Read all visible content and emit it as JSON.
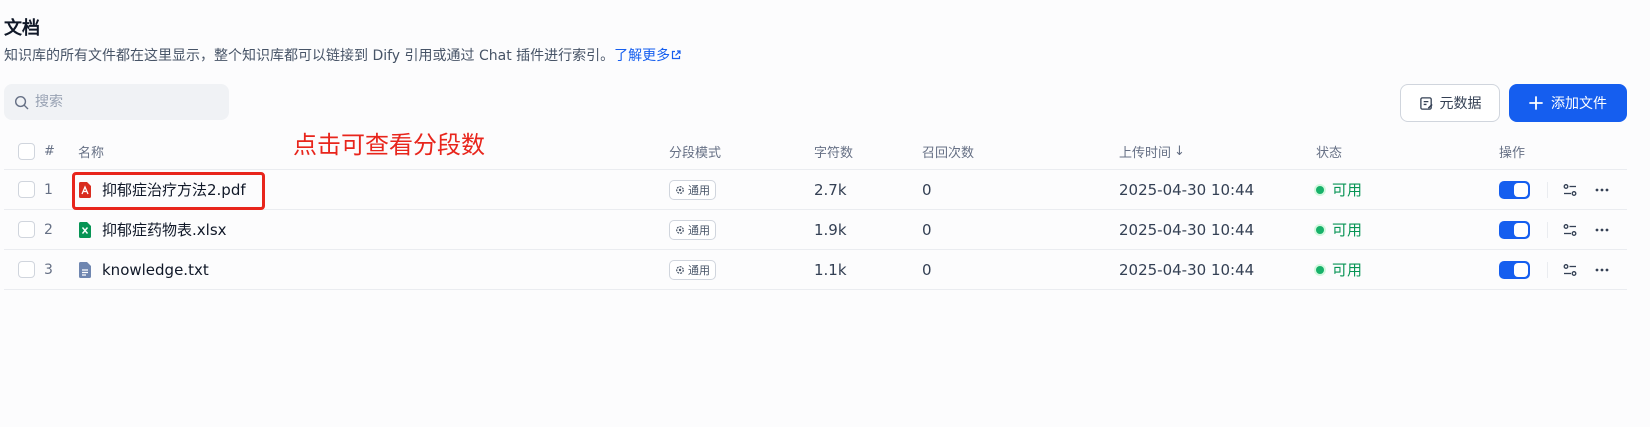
{
  "header": {
    "title": "文档",
    "description": "知识库的所有文件都在这里显示，整个知识库都可以链接到 Dify 引用或通过 Chat 插件进行索引。",
    "learn_more": "了解更多"
  },
  "search": {
    "placeholder": "搜索",
    "value": ""
  },
  "toolbar": {
    "metadata_label": "元数据",
    "add_file_label": "添加文件"
  },
  "annotation": "点击可查看分段数",
  "table": {
    "columns": {
      "num": "#",
      "name": "名称",
      "mode": "分段模式",
      "chars": "字符数",
      "recall": "召回次数",
      "upload_time": "上传时间",
      "status": "状态",
      "ops": "操作"
    },
    "rows": [
      {
        "num": "1",
        "name": "抑郁症治疗方法2.pdf",
        "file_type": "pdf",
        "mode": "通用",
        "chars": "2.7k",
        "recall": "0",
        "upload_time": "2025-04-30 10:44",
        "status": "可用",
        "enabled": true
      },
      {
        "num": "2",
        "name": "抑郁症药物表.xlsx",
        "file_type": "xlsx",
        "mode": "通用",
        "chars": "1.9k",
        "recall": "0",
        "upload_time": "2025-04-30 10:44",
        "status": "可用",
        "enabled": true
      },
      {
        "num": "3",
        "name": "knowledge.txt",
        "file_type": "txt",
        "mode": "通用",
        "chars": "1.1k",
        "recall": "0",
        "upload_time": "2025-04-30 10:44",
        "status": "可用",
        "enabled": true
      }
    ]
  },
  "colors": {
    "accent": "#155eef",
    "status_green": "#17b26a",
    "annotation_red": "#e8251c",
    "pdf_icon": "#d92d20",
    "xlsx_icon": "#079455",
    "txt_icon": "#6f86b0"
  },
  "icons": {
    "search": "search-icon",
    "metadata": "edit-document-icon",
    "add": "plus-icon",
    "pdf": "pdf-file-icon",
    "xlsx": "excel-file-icon",
    "txt": "text-file-icon",
    "mode": "gear-icon",
    "settings": "sliders-icon",
    "more": "more-dots-icon",
    "external": "external-link-icon"
  }
}
